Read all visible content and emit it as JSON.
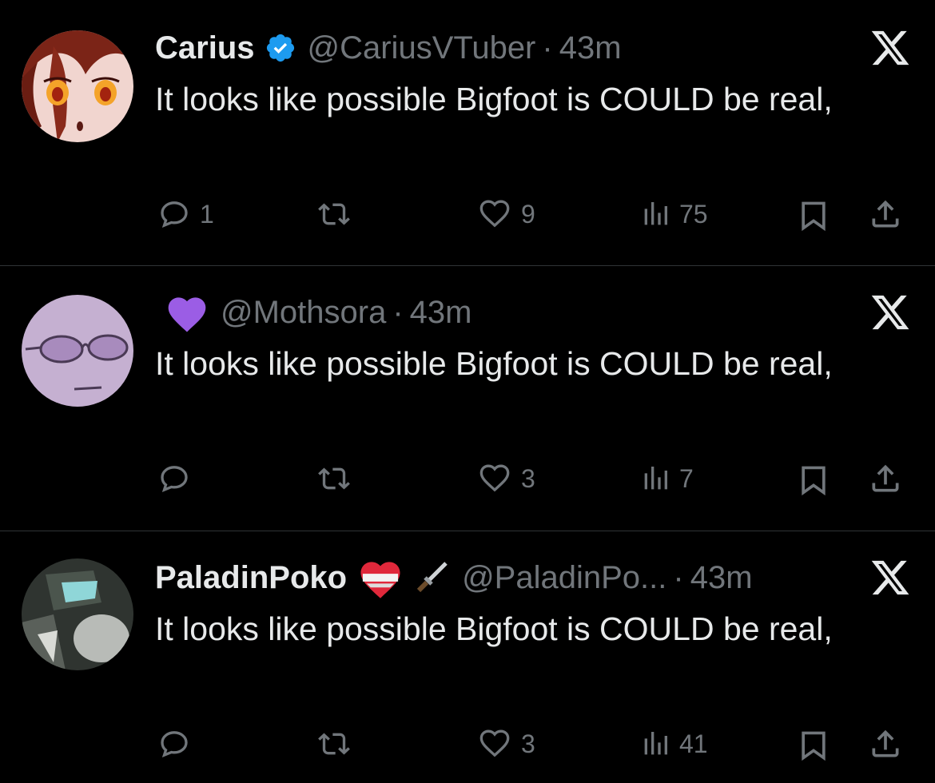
{
  "tweets": [
    {
      "name": "Carius",
      "verified": true,
      "handle": "@CariusVTuber",
      "separator": "·",
      "time": "43m",
      "text": "It looks like possible Bigfoot is COULD be real,",
      "replies": "1",
      "retweets": "",
      "likes": "9",
      "views": "75",
      "avatar_palette": [
        "#f2d7d0",
        "#7a1f14",
        "#ff8a1c"
      ]
    },
    {
      "name": "",
      "name_emoji": "purple-heart",
      "handle": "@Mothsora",
      "separator": "·",
      "time": "43m",
      "text": "It looks like possible Bigfoot is COULD be real,",
      "replies": "",
      "retweets": "",
      "likes": "3",
      "views": "7",
      "avatar_palette": [
        "#c7b2d2",
        "#9a80b0",
        "#4a3a55"
      ]
    },
    {
      "name": "PaladinPoko",
      "name_emoji": [
        "mending-heart",
        "dagger"
      ],
      "handle": "@PaladinPo...",
      "separator": "·",
      "time": "43m",
      "text": "It looks like possible Bigfoot is COULD be real,",
      "replies": "",
      "retweets": "",
      "likes": "3",
      "views": "41",
      "avatar_palette": [
        "#3a3f3a",
        "#8fd6d8",
        "#b9bcb8"
      ]
    }
  ],
  "colors": {
    "background": "#000000",
    "primary_text": "#e7e9ea",
    "secondary_text": "#71767b",
    "divider": "#2f3336",
    "verified_blue": "#1d9bf0",
    "purple_heart": "#9b5de5"
  },
  "icons": {
    "reply": "reply-icon",
    "retweet": "retweet-icon",
    "like": "heart-icon",
    "views": "views-icon",
    "bookmark": "bookmark-icon",
    "share": "share-icon",
    "logo": "x-logo-icon"
  }
}
